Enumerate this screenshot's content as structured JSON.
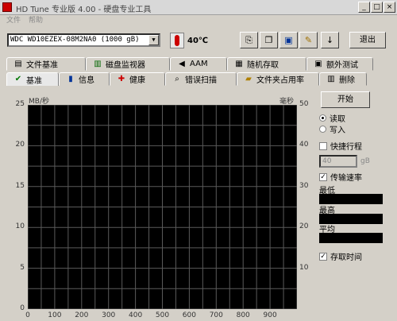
{
  "window": {
    "title": "HD Tune 专业版 4.00 - 硬盘专业工具",
    "min_glyph": "_",
    "max_glyph": "□",
    "close_glyph": "×"
  },
  "menu": [
    "文件",
    "帮助"
  ],
  "toolbar": {
    "drive": "WDC WD10EZEX-08M2NA0 (1000 gB)",
    "temperature": "40℃",
    "exit_label": "退出",
    "buttons": [
      "copy-info",
      "copy-screen",
      "save",
      "options",
      "download"
    ]
  },
  "tabs_top": [
    {
      "label": "文件基准",
      "icon": "file-bench-icon"
    },
    {
      "label": "磁盘监视器",
      "icon": "disk-monitor-icon"
    },
    {
      "label": "AAM",
      "icon": "speaker-icon"
    },
    {
      "label": "随机存取",
      "icon": "random-access-icon"
    },
    {
      "label": "额外测试",
      "icon": "extra-tests-icon"
    }
  ],
  "tabs_bottom": [
    {
      "label": "基准",
      "icon": "benchmark-icon",
      "active": true
    },
    {
      "label": "信息",
      "icon": "info-icon"
    },
    {
      "label": "健康",
      "icon": "health-icon"
    },
    {
      "label": "错误扫描",
      "icon": "error-scan-icon"
    },
    {
      "label": "文件夹占用率",
      "icon": "folder-usage-icon"
    },
    {
      "label": "删除",
      "icon": "erase-icon"
    }
  ],
  "chart_data": {
    "type": "line",
    "ylabel": "MB/秒",
    "y2label": "毫秒",
    "ylim": [
      0,
      25
    ],
    "y2lim": [
      0,
      50
    ],
    "xlim": [
      0,
      1000
    ],
    "y_ticks": [
      0,
      5,
      10,
      15,
      20,
      25
    ],
    "y2_ticks": [
      10,
      20,
      30,
      40,
      50
    ],
    "x_ticks": [
      0,
      100,
      200,
      300,
      400,
      500,
      600,
      700,
      800,
      900
    ],
    "grid": true,
    "series": []
  },
  "panel": {
    "start_label": "开始",
    "read_label": "读取",
    "write_label": "写入",
    "short_stroke_label": "快捷行程",
    "short_stroke_value": "40",
    "short_stroke_unit": "gB",
    "transfer_rate_label": "传输速率",
    "min_label": "最低",
    "max_label": "最高",
    "avg_label": "平均",
    "access_time_label": "存取时间"
  },
  "colors": {
    "plot_bg": "#000000",
    "grid": "#5a5a5a",
    "window_bg": "#d4d0c8"
  }
}
